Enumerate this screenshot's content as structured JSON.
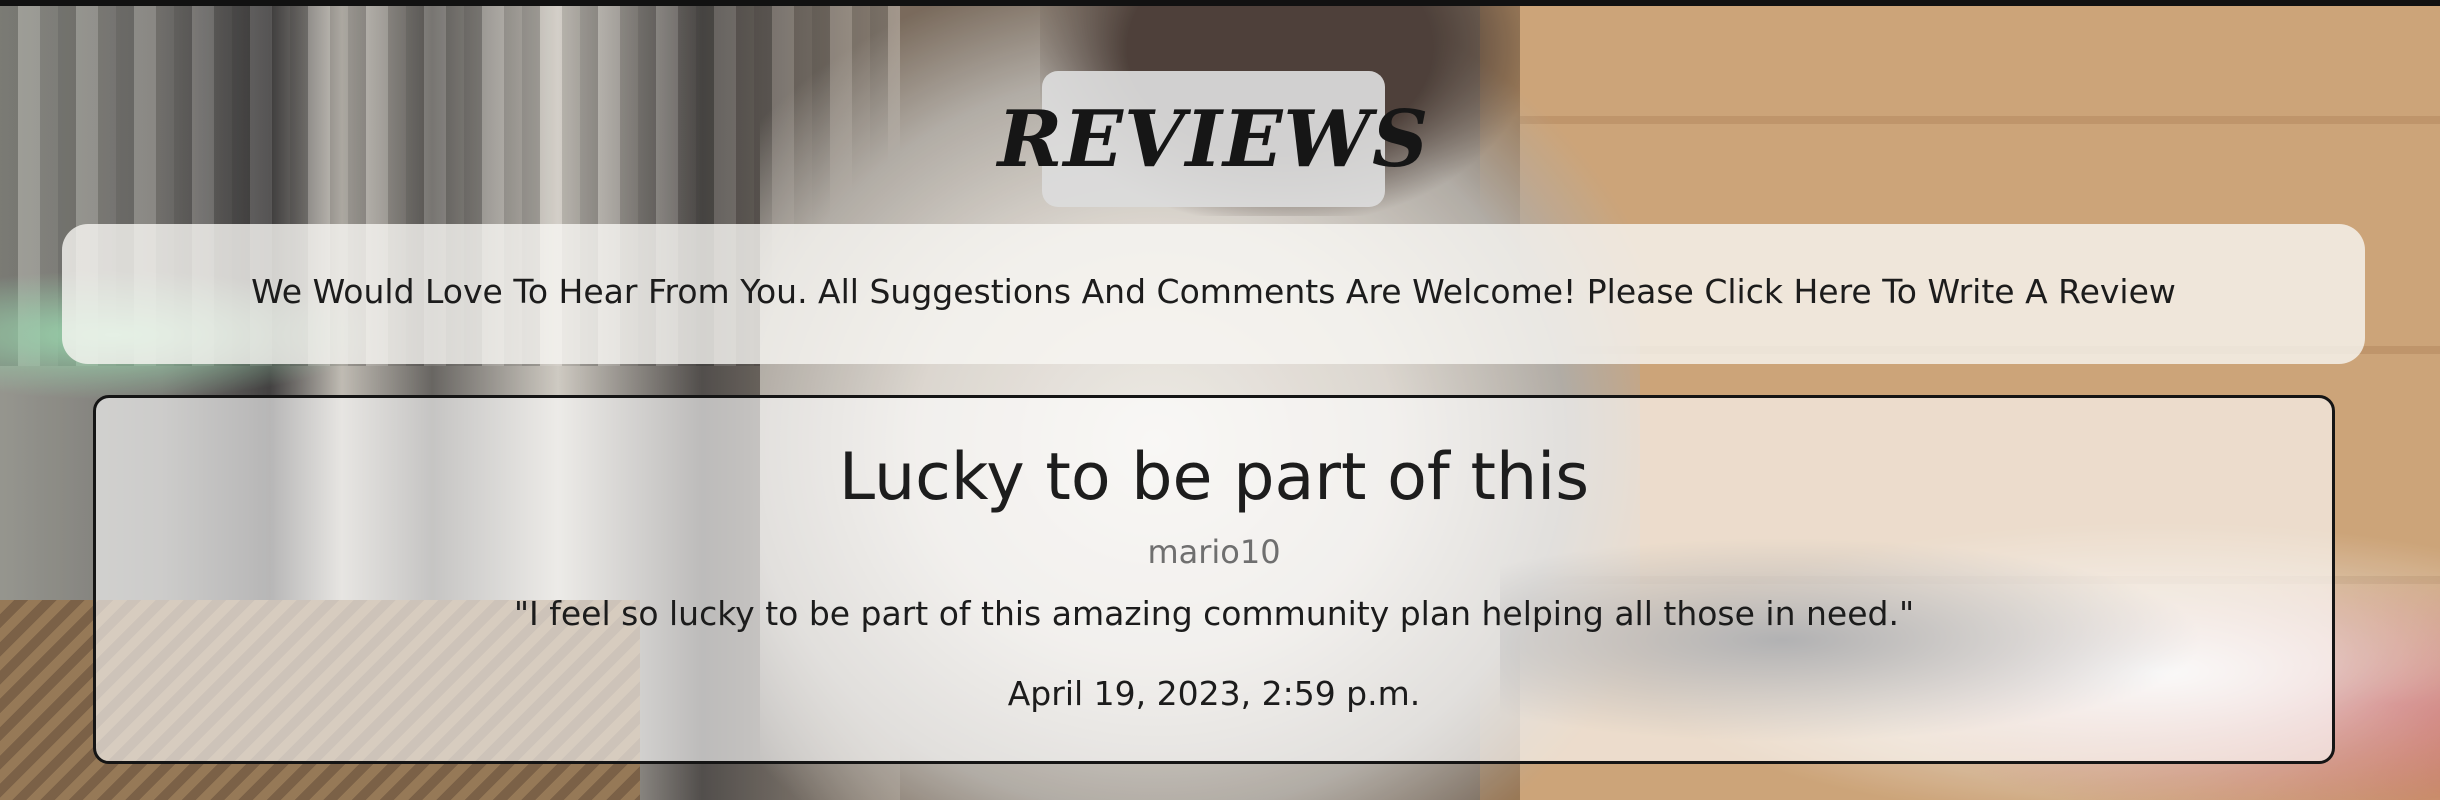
{
  "page": {
    "heading": "REVIEWS",
    "banner_text": "We Would Love To Hear From You. All Suggestions And Comments Are Welcome! Please Click Here To Write A Review"
  },
  "reviews": [
    {
      "title": "Lucky to be part of this",
      "author": "mario10",
      "body": "\"I feel so lucky to be part of this amazing community plan helping all those in need.\"",
      "date": "April 19, 2023, 2:59 p.m."
    }
  ],
  "colors": {
    "text_dark": "#1c1c1c",
    "text_muted": "#6f6f6f",
    "card_border": "#151515"
  }
}
